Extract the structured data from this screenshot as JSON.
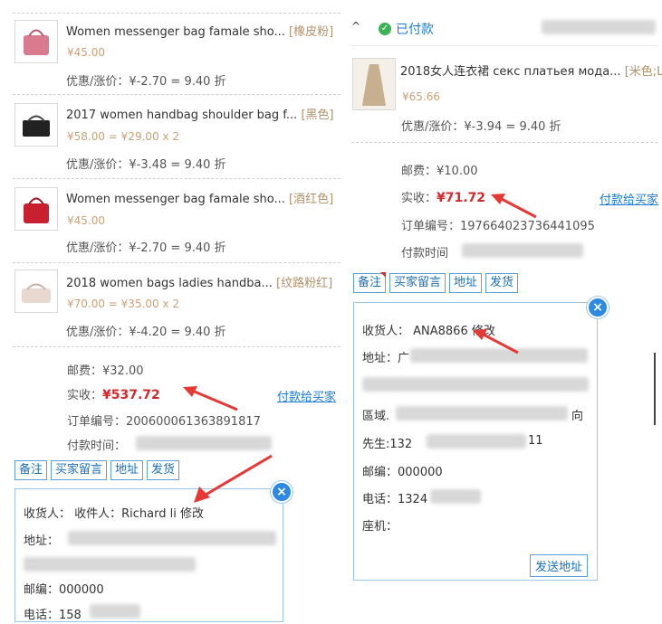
{
  "left": {
    "items": [
      {
        "title": "Women messenger bag famale sho...",
        "spec": "[橡皮粉]",
        "price": "¥45.00",
        "discount": "优惠/涨价：¥-2.70 = 9.40 折"
      },
      {
        "title": "2017 women handbag shoulder bag f...",
        "spec": "[黑色]",
        "price": "¥58.00 = ¥29.00 x 2",
        "discount": "优惠/涨价：¥-3.48 = 9.40 折"
      },
      {
        "title": "Women messenger bag famale sho...",
        "spec": "[酒红色]",
        "price": "¥45.00",
        "discount": "优惠/涨价：¥-2.70 = 9.40 折"
      },
      {
        "title": "2018 women bags ladies handba...",
        "spec": "[纹路粉红]",
        "price": "¥70.00 = ¥35.00 x 2",
        "discount": "优惠/涨价：¥-4.20 = 9.40 折"
      }
    ],
    "shipping": "邮费：¥32.00",
    "received_label": "实收：",
    "received_value": "¥537.72",
    "pay_link": "付款给买家",
    "order_no": "订单编号：20060006136389181­7",
    "pay_time_label": "付款时间：",
    "buttons": [
      "备注",
      "买家留言",
      "地址",
      "发货"
    ],
    "popup": {
      "receiver": "收货人： 收件人：Richard li 修改",
      "address": "地址：",
      "postcode": "邮编：000000",
      "phone": "电话：158"
    }
  },
  "right": {
    "status": "已付款",
    "status_caret": "^",
    "item": {
      "title": "2018女人连衣裙 секс платьея мода...",
      "spec": "[米色;L]",
      "price": "¥65.66",
      "discount": "优惠/涨价：¥-3.94 = 9.40 折"
    },
    "shipping": "邮费：¥10.00",
    "received_label": "实收：",
    "received_value": "¥71.72",
    "pay_link": "付款给买家",
    "order_no": "订单编号：19766402373644109­5",
    "pay_time_label": "付款时间",
    "buttons": [
      "备注",
      "买家留言",
      "地址",
      "发货"
    ],
    "popup": {
      "receiver": "收货人： ANA8866 修改",
      "address": "地址：广",
      "line3_a": "區域.",
      "line3_b": "向",
      "mister": "先生:132",
      "mister_tail": "11",
      "postcode": "邮编：000000",
      "phone": "电话：1324",
      "landline": "座机：",
      "send_btn": "发送地址"
    }
  },
  "colors": {
    "accent": "#1a7ad4",
    "price_red": "#d4282b",
    "arrow": "#e53935",
    "paid_green": "#3db155"
  }
}
